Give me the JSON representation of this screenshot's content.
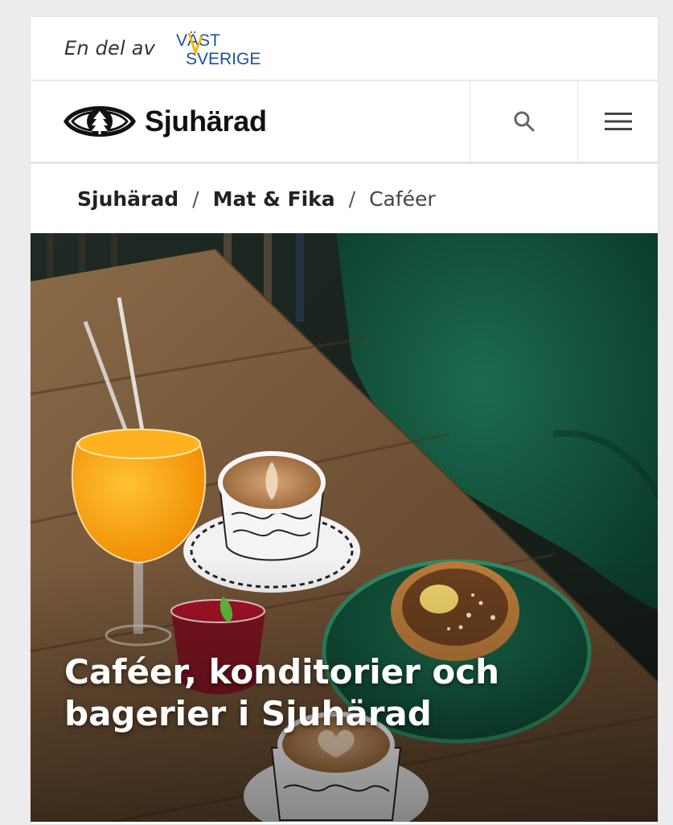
{
  "partner": {
    "prefix": "En del av",
    "logo_top": "VÄST",
    "logo_bottom": "SVERIGE"
  },
  "header": {
    "site_name": "Sjuhärad",
    "logo_icon": "eye-tree-icon",
    "search_icon": "search-icon",
    "menu_icon": "hamburger-menu-icon"
  },
  "breadcrumb": {
    "items": [
      "Sjuhärad",
      "Mat & Fika"
    ],
    "current": "Caféer",
    "separator": "/"
  },
  "hero": {
    "title": "Caféer, konditorier och bagerier i Sjuhärad"
  },
  "colors": {
    "accent_blue": "#1d4f9c",
    "accent_yellow": "#f2b800",
    "pillow_green": "#0e4a35",
    "table_wood": "#7a5a3a"
  }
}
